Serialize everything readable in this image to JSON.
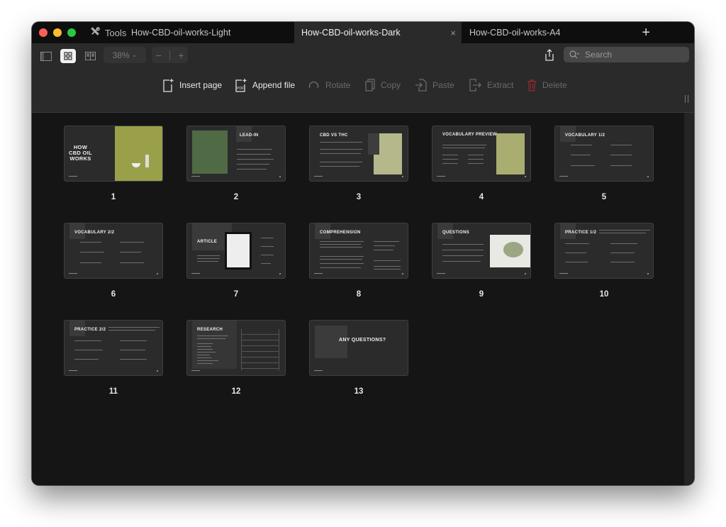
{
  "window": {
    "traffic_lights": {
      "close": "#ff5f57",
      "minimize": "#febc2e",
      "zoom": "#28c840"
    },
    "tools_label": "Tools",
    "tabs": [
      {
        "label": "How-CBD-oil-works-Light",
        "active": false
      },
      {
        "label": "How-CBD-oil-works-Dark",
        "active": true
      },
      {
        "label": "How-CBD-oil-works-A4",
        "active": false
      }
    ],
    "new_tab": "+",
    "close_tab": "×"
  },
  "toolbar": {
    "view_modes": [
      "sidebar-view",
      "grid-view",
      "two-page-view"
    ],
    "active_view": "grid-view",
    "zoom_level": "38%",
    "zoom_out": "−",
    "zoom_in": "+",
    "search_placeholder": "Search",
    "actions": [
      {
        "label": "Insert page",
        "enabled": true,
        "icon": "insert-page-icon"
      },
      {
        "label": "Append file",
        "enabled": true,
        "icon": "append-file-icon"
      },
      {
        "label": "Rotate",
        "enabled": false,
        "icon": "rotate-icon"
      },
      {
        "label": "Copy",
        "enabled": false,
        "icon": "copy-icon"
      },
      {
        "label": "Paste",
        "enabled": false,
        "icon": "paste-icon"
      },
      {
        "label": "Extract",
        "enabled": false,
        "icon": "extract-icon"
      },
      {
        "label": "Delete",
        "enabled": false,
        "icon": "trash-icon"
      }
    ]
  },
  "pages": [
    {
      "number": "1",
      "title": "HOW\nCBD OIL\nWORKS",
      "kind": "cover"
    },
    {
      "number": "2",
      "title": "LEAD-IN",
      "kind": "image-left"
    },
    {
      "number": "3",
      "title": "CBD VS THC",
      "kind": "image-right"
    },
    {
      "number": "4",
      "title": "VOCABULARY PREVIEW",
      "kind": "image-right"
    },
    {
      "number": "5",
      "title": "VOCABULARY 1/2",
      "kind": "text"
    },
    {
      "number": "6",
      "title": "VOCABULARY 2/2",
      "kind": "text"
    },
    {
      "number": "7",
      "title": "ARTICLE",
      "kind": "article"
    },
    {
      "number": "8",
      "title": "COMPREHENSION",
      "kind": "text"
    },
    {
      "number": "9",
      "title": "QUESTIONS",
      "kind": "image-right"
    },
    {
      "number": "10",
      "title": "PRACTICE 1/2",
      "kind": "text"
    },
    {
      "number": "11",
      "title": "PRACTICE 2/2",
      "kind": "text"
    },
    {
      "number": "12",
      "title": "RESEARCH",
      "kind": "table"
    },
    {
      "number": "13",
      "title": "ANY QUESTIONS?",
      "kind": "end"
    }
  ],
  "colors": {
    "bg": "#151515",
    "toolbar": "#2a2a2a",
    "tab_active": "#2a2a2a",
    "delete_icon": "#8b2a2a",
    "slide_bg": "#2b2b2b",
    "olive": "#9aa04a"
  }
}
